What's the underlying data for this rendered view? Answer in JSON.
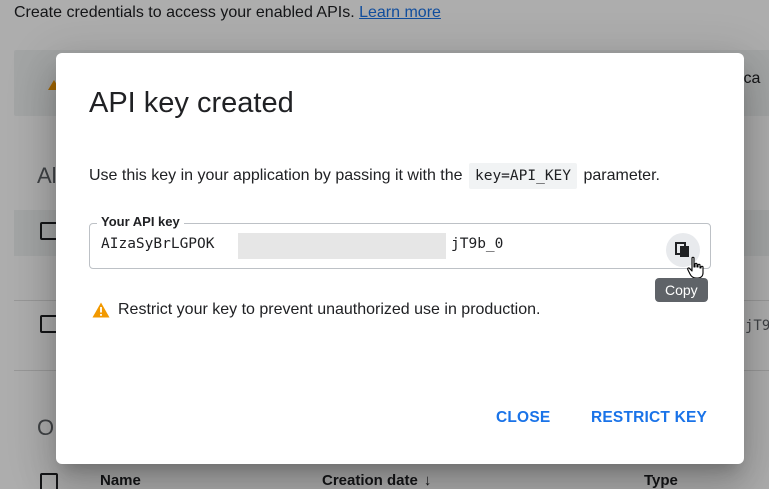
{
  "background": {
    "intro_text": "Create credentials to access your enabled APIs.",
    "learn_more": "Learn more",
    "banner_text": "ica",
    "section_api_keys": "Al",
    "section_oauth": "O.",
    "partial_key": "jT9",
    "table": {
      "col_name": "Name",
      "col_creation_date": "Creation date",
      "sort_arrow": "↓",
      "col_type": "Type"
    }
  },
  "dialog": {
    "title": "API key created",
    "description_before": "Use this key in your application by passing it with the",
    "description_code": "key=API_KEY",
    "description_after": "parameter.",
    "key_label": "Your API key",
    "key_visible_start": "AIzaSyBrLGPOK",
    "key_visible_end": "jT9b_0",
    "copy_tooltip": "Copy",
    "warning_text": "Restrict your key to prevent unauthorized use in production.",
    "close_label": "CLOSE",
    "restrict_label": "RESTRICT KEY"
  },
  "colors": {
    "accent": "#1a73e8",
    "warning": "#f29900",
    "text": "#202124"
  },
  "icons": {
    "copy": "copy-icon",
    "warning": "warning-icon",
    "cursor": "pointer-hand-icon"
  }
}
